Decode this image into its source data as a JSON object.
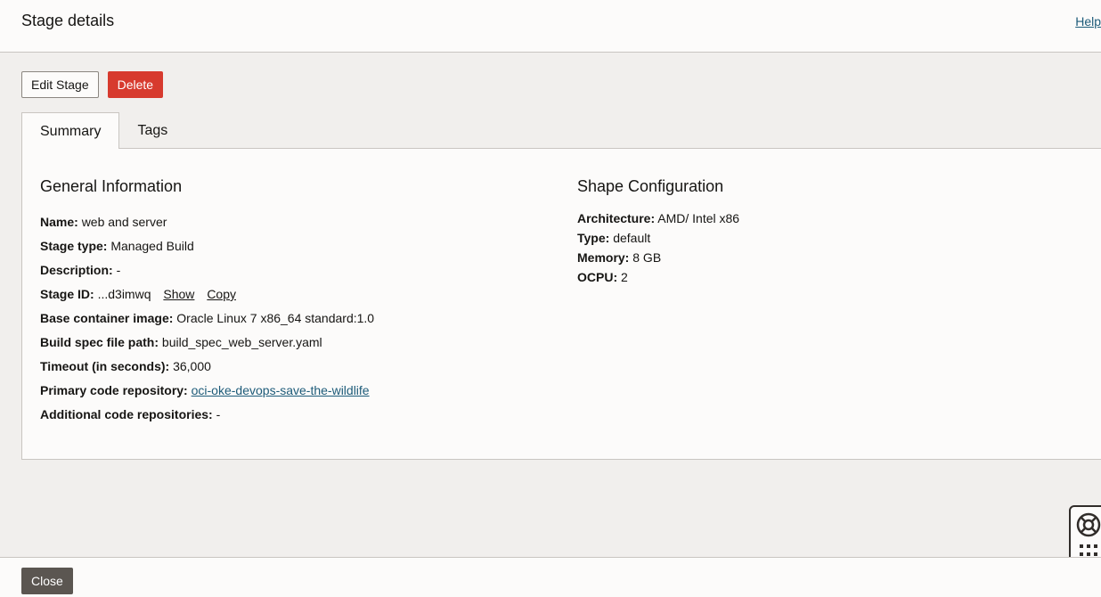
{
  "header": {
    "title": "Stage details",
    "help_label": "Help"
  },
  "actions": {
    "edit_label": "Edit Stage",
    "delete_label": "Delete"
  },
  "tabs": [
    {
      "label": "Summary",
      "active": true
    },
    {
      "label": "Tags",
      "active": false
    }
  ],
  "general": {
    "title": "General Information",
    "name": {
      "label": "Name:",
      "value": "web and server"
    },
    "stage_type": {
      "label": "Stage type:",
      "value": "Managed Build"
    },
    "description": {
      "label": "Description:",
      "value": "-"
    },
    "stage_id": {
      "label": "Stage ID:",
      "value": "...d3imwq",
      "show_label": "Show",
      "copy_label": "Copy"
    },
    "base_image": {
      "label": "Base container image:",
      "value": "Oracle Linux 7 x86_64 standard:1.0"
    },
    "build_spec": {
      "label": "Build spec file path:",
      "value": "build_spec_web_server.yaml"
    },
    "timeout": {
      "label": "Timeout (in seconds):",
      "value": "36,000"
    },
    "primary_repo": {
      "label": "Primary code repository:",
      "value": "oci-oke-devops-save-the-wildlife"
    },
    "additional_repos": {
      "label": "Additional code repositories:",
      "value": "-"
    }
  },
  "shape": {
    "title": "Shape Configuration",
    "architecture": {
      "label": "Architecture:",
      "value": "AMD/ Intel x86"
    },
    "type": {
      "label": "Type:",
      "value": "default"
    },
    "memory": {
      "label": "Memory:",
      "value": "8 GB"
    },
    "ocpu": {
      "label": "OCPU:",
      "value": "2"
    }
  },
  "footer": {
    "close_label": "Close"
  },
  "icons": {
    "helper_ring": "lifebuoy-icon",
    "helper_grid": "app-grid-icon"
  },
  "colors": {
    "danger": "#d73a2e",
    "link": "#1d5b79",
    "close_bg": "#5b5651"
  }
}
